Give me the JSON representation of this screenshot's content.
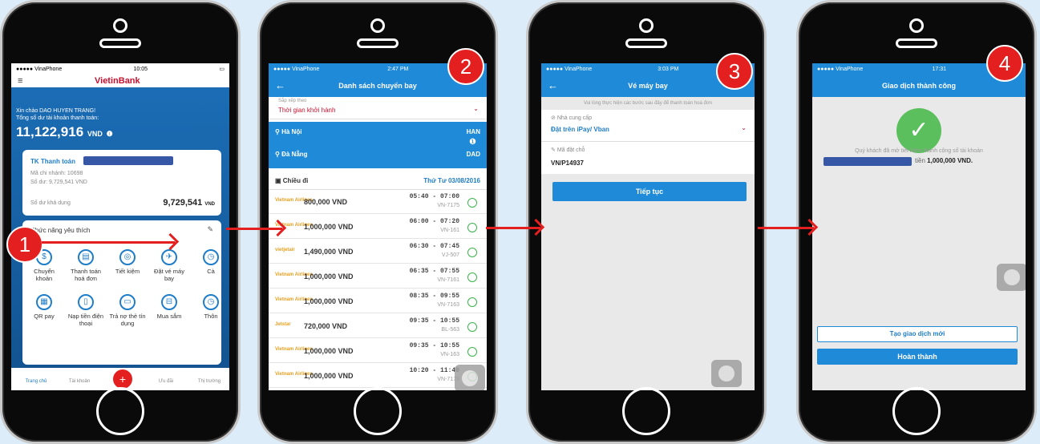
{
  "steps": [
    "1",
    "2",
    "3",
    "4"
  ],
  "phone1": {
    "status": {
      "carrier": "●●●●● VinaPhone",
      "time": "10:05"
    },
    "logo": "VietinBank",
    "greeting": "Xin chào DAO HUYEN TRANG!",
    "balance_label": "Tổng số dư tài khoản thanh toán:",
    "balance": "11,122,916",
    "currency": "VND",
    "account_title": "TK Thanh toán",
    "branch": "Mã chi nhánh: 10698",
    "acct_balance": "Số dư: 9,729,541 VND",
    "available_label": "Số dư khả dụng",
    "available": "9,729,541",
    "available_cur": "VND",
    "fav_title": "Chức năng yêu thích",
    "features": [
      {
        "icon": "$",
        "label": "Chuyển khoản"
      },
      {
        "icon": "▤",
        "label": "Thanh toán hoá đơn"
      },
      {
        "icon": "◎",
        "label": "Tiết kiệm"
      },
      {
        "icon": "✈",
        "label": "Đặt vé máy bay"
      },
      {
        "icon": "◷",
        "label": "Cà"
      },
      {
        "icon": "▦",
        "label": "QR pay"
      },
      {
        "icon": "▯",
        "label": "Nạp tiền điện thoại"
      },
      {
        "icon": "▭",
        "label": "Trả nợ thẻ tín dụng"
      },
      {
        "icon": "⊟",
        "label": "Mua sắm"
      },
      {
        "icon": "◷",
        "label": "Thôn"
      }
    ],
    "nav": [
      "Trang chủ",
      "Tài khoản",
      "+",
      "Ưu đãi",
      "Thị trường"
    ]
  },
  "phone2": {
    "status": {
      "carrier": "●●●●● VinaPhone",
      "time": "2:47 PM"
    },
    "title": "Danh sách chuyến bay",
    "sort_label": "Sắp xếp theo",
    "sort_value": "Thời gian khởi hành",
    "from": "Hà Nội",
    "from_code": "HAN",
    "to": "Đà Nẵng",
    "to_code": "DAD",
    "direction": "Chiều đi",
    "date": "Thứ Tư 03/08/2016",
    "flights": [
      {
        "airline": "Vietnam Airlines",
        "price": "800,000 VND",
        "time": "05:40 - 07:00",
        "code": "VN-7175"
      },
      {
        "airline": "Vietnam Airlines",
        "price": "1,000,000 VND",
        "time": "06:00 - 07:20",
        "code": "VN-161"
      },
      {
        "airline": "vietjetair",
        "price": "1,490,000 VND",
        "time": "06:30 - 07:45",
        "code": "VJ-507"
      },
      {
        "airline": "Vietnam Airlines",
        "price": "1,000,000 VND",
        "time": "06:35 - 07:55",
        "code": "VN-7161"
      },
      {
        "airline": "Vietnam Airlines",
        "price": "1,000,000 VND",
        "time": "08:35 - 09:55",
        "code": "VN-7163"
      },
      {
        "airline": "Jetstar",
        "price": "720,000 VND",
        "time": "09:35 - 10:55",
        "code": "BL-563"
      },
      {
        "airline": "Vietnam Airlines",
        "price": "1,000,000 VND",
        "time": "09:35 - 10:55",
        "code": "VN-163"
      },
      {
        "airline": "Vietnam Airlines",
        "price": "1,000,000 VND",
        "time": "10:20 - 11:40",
        "code": "VN-7179"
      }
    ]
  },
  "phone3": {
    "status": {
      "carrier": "●●●●● VinaPhone",
      "time": "3:03 PM"
    },
    "title": "Vé máy bay",
    "note": "Vui lòng thực hiện các bước sau đây để thanh toán hoá đơn",
    "provider_label": "Nhà cung cấp",
    "provider_value": "Đặt trên iPay/ Vban",
    "booking_label": "Mã đặt chỗ",
    "booking_value": "VN/P14937",
    "continue": "Tiếp tục"
  },
  "phone4": {
    "status": {
      "carrier": "●●●●● VinaPhone",
      "time": "17:31"
    },
    "title": "Giao dịch thành công",
    "message": "Quý khách đã mở tiết kiệm thành công số tài khoản",
    "amount_prefix": "tiền",
    "amount": "1,000,000 VND.",
    "new_tx": "Tạo giao dịch mới",
    "done": "Hoàn thành"
  }
}
